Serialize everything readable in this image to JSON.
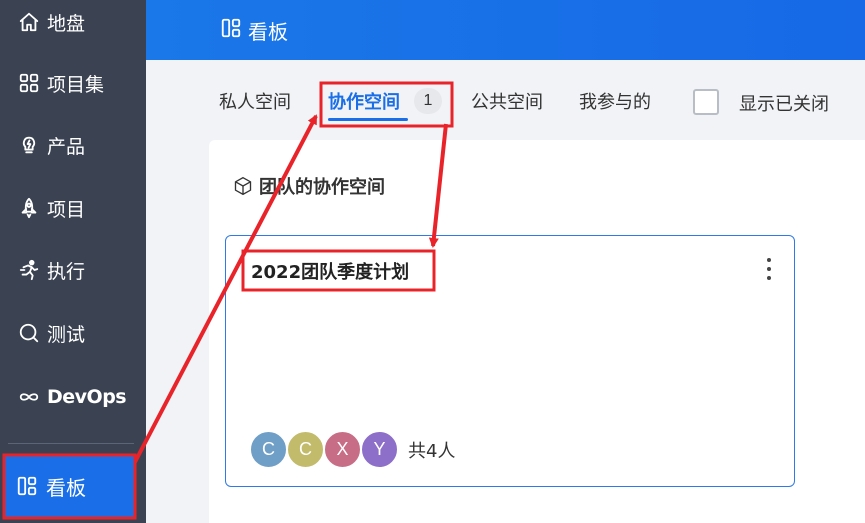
{
  "sidebar": {
    "items": [
      {
        "label": "地盘",
        "icon": "home-icon"
      },
      {
        "label": "项目集",
        "icon": "grid-icon"
      },
      {
        "label": "产品",
        "icon": "lightbulb-icon"
      },
      {
        "label": "项目",
        "icon": "rocket-icon"
      },
      {
        "label": "执行",
        "icon": "running-icon"
      },
      {
        "label": "测试",
        "icon": "search-icon"
      },
      {
        "label": "DevOps",
        "icon": "infinity-icon"
      }
    ],
    "active": {
      "label": "看板",
      "icon": "board-icon"
    }
  },
  "header": {
    "title": "看板",
    "icon": "board-icon"
  },
  "tabs": {
    "items": [
      {
        "label": "私人空间"
      },
      {
        "label": "协作空间",
        "badge": "1"
      },
      {
        "label": "公共空间"
      },
      {
        "label": "我参与的"
      }
    ],
    "active_index": 1,
    "show_closed_label": "显示已关闭"
  },
  "section": {
    "title": "团队的协作空间",
    "icon": "cube-icon"
  },
  "card": {
    "title": "2022团队季度计划",
    "members": [
      {
        "initial": "C",
        "color": "#6f9fc6"
      },
      {
        "initial": "C",
        "color": "#c2bb6b"
      },
      {
        "initial": "X",
        "color": "#c86d86"
      },
      {
        "initial": "Y",
        "color": "#8d6fc9"
      }
    ],
    "member_count": "共4人"
  },
  "colors": {
    "accent": "#1a6fe8",
    "annotation": "#e8242a",
    "sidebar_bg": "#3b4353"
  }
}
